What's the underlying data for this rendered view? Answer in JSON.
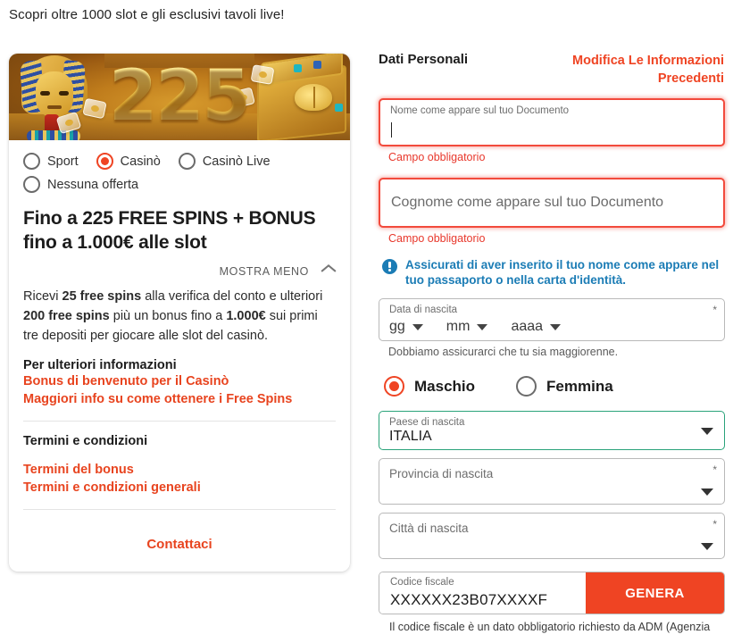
{
  "tagline": "Scopri oltre 1000 slot e gli esclusivi tavoli live!",
  "promo": {
    "banner": {
      "number": "225",
      "alt_name": "egyptian-slot-banner"
    },
    "offers": [
      {
        "label": "Sport",
        "selected": false
      },
      {
        "label": "Casinò",
        "selected": true
      },
      {
        "label": "Casinò Live",
        "selected": false
      },
      {
        "label": "Nessuna offerta",
        "selected": false
      }
    ],
    "headline": "Fino a 225 FREE SPINS + BONUS fino a 1.000€ alle slot",
    "toggle_label": "MOSTRA MENO",
    "description_parts": [
      {
        "text": "Ricevi ",
        "bold": false
      },
      {
        "text": "25 free spins",
        "bold": true
      },
      {
        "text": " alla verifica del conto e ulteriori ",
        "bold": false
      },
      {
        "text": "200 free spins",
        "bold": true
      },
      {
        "text": " più un bonus fino a ",
        "bold": false
      },
      {
        "text": "1.000€",
        "bold": true
      },
      {
        "text": " sui primi tre depositi per giocare alle slot del casinò.",
        "bold": false
      }
    ],
    "more_info_title": "Per ulteriori informazioni",
    "more_info_links": [
      "Bonus di benvenuto per il Casinò",
      "Maggiori info su come ottenere i Free Spins"
    ],
    "terms_title": "Termini e condizioni",
    "terms_links": [
      "Termini del bonus",
      "Termini e condizioni generali"
    ],
    "contact_label": "Contattaci"
  },
  "form": {
    "title": "Dati Personali",
    "edit_previous": "Modifica Le Informazioni Precedenti",
    "first_name": {
      "label": "Nome come appare sul tuo Documento",
      "value": "",
      "error": "Campo obbligatorio"
    },
    "last_name": {
      "placeholder": "Cognome come appare sul tuo Documento",
      "value": "",
      "error": "Campo obbligatorio"
    },
    "notice": "Assicurati di aver inserito il tuo nome come appare nel tuo passaporto o nella carta d'identità.",
    "birth_date": {
      "label": "Data di nascita",
      "required_mark": "*",
      "day": "gg",
      "month": "mm",
      "year": "aaaa",
      "hint": "Dobbiamo assicurarci che tu sia maggiorenne."
    },
    "gender": {
      "options": [
        {
          "label": "Maschio",
          "selected": true
        },
        {
          "label": "Femmina",
          "selected": false
        }
      ]
    },
    "country": {
      "label": "Paese di nascita",
      "value": "ITALIA",
      "required_mark": ""
    },
    "province": {
      "label": "Provincia di nascita",
      "value": "",
      "required_mark": "*"
    },
    "city": {
      "label": "Città di nascita",
      "value": "",
      "required_mark": "*"
    },
    "fiscal_code": {
      "label": "Codice fiscale",
      "value": "XXXXXX23B07XXXXF",
      "button": "GENERA",
      "note": "Il codice fiscale è un dato obbligatorio richiesto da ADM (Agenzia"
    }
  },
  "colors": {
    "accent_orange": "#ef4423",
    "link_orange": "#e8441f",
    "error_red": "#f24a3c",
    "info_blue": "#1b7cb5",
    "valid_green": "#2aa37a"
  }
}
